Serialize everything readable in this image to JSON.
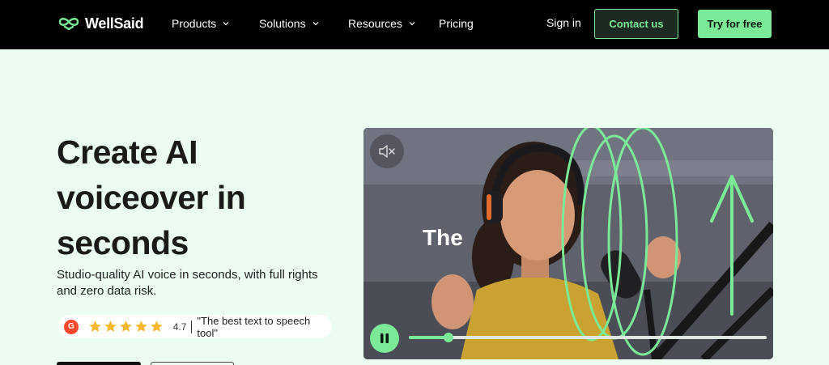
{
  "nav": {
    "brand": "WellSaid",
    "items": [
      {
        "label": "Products",
        "has_dropdown": true
      },
      {
        "label": "Solutions",
        "has_dropdown": true
      },
      {
        "label": "Resources",
        "has_dropdown": true
      },
      {
        "label": "Pricing",
        "has_dropdown": false
      }
    ],
    "sign_in": "Sign in",
    "contact": "Contact us",
    "try_free": "Try for free"
  },
  "hero": {
    "title": "Create AI voiceover in seconds",
    "subtitle": "Studio-quality AI voice in seconds, with full rights and zero data risk.",
    "rating": {
      "badge": "G",
      "stars": 5,
      "value": "4.7",
      "quote": "\"The best text to speech tool\""
    }
  },
  "video": {
    "overlay_word": "The",
    "progress": 0.11,
    "muted": true,
    "playing": true
  },
  "colors": {
    "accent": "#7bea97",
    "nav_bg": "#000000",
    "page_bg": "#eafdf0",
    "star": "#f5b82e",
    "g2": "#ff492c"
  },
  "icons": {
    "logo": "wellsaid-logo-icon",
    "dropdown": "chevron-down-icon",
    "mute": "speaker-muted-icon",
    "pause": "pause-icon",
    "star": "star-icon"
  }
}
